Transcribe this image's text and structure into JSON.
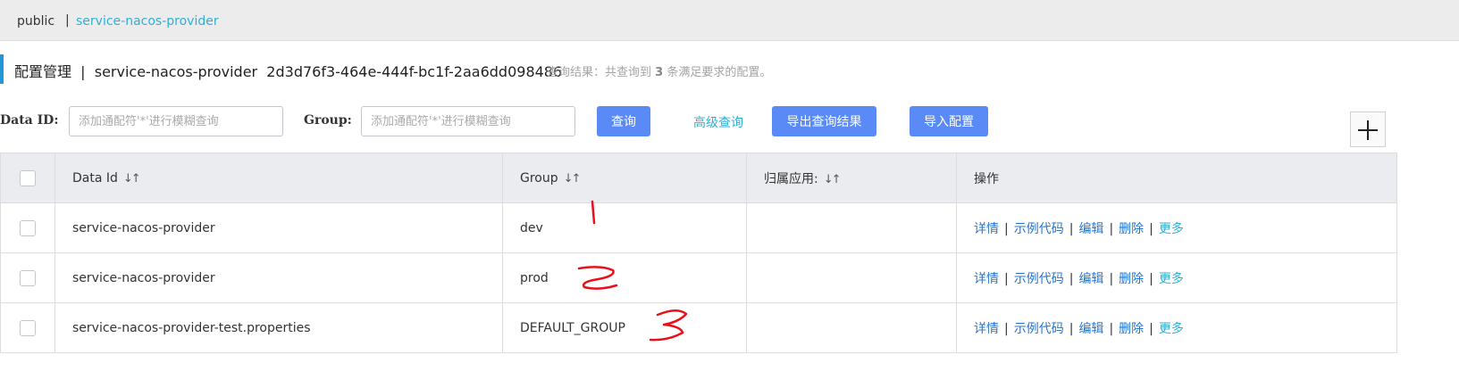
{
  "namespace_bar": {
    "public": "public",
    "separator": "|",
    "active": "service-nacos-provider"
  },
  "header": {
    "title": "配置管理  |  service-nacos-provider  2d3d76f3-464e-444f-bc1f-2aa6dd098486",
    "query_result_prefix": "查询结果：共查询到",
    "query_result_count": "3",
    "query_result_suffix": "条满足要求的配置。"
  },
  "filters": {
    "data_id_label": "Data ID:",
    "data_id_placeholder": "添加通配符'*'进行模糊查询",
    "group_label": "Group:",
    "group_placeholder": "添加通配符'*'进行模糊查询",
    "search_button": "查询",
    "advanced_link": "高级查询",
    "export_button": "导出查询结果",
    "import_button": "导入配置"
  },
  "table": {
    "columns": [
      "Data Id",
      "Group",
      "归属应用:",
      "操作"
    ],
    "rows": [
      {
        "data_id": "service-nacos-provider",
        "group": "dev",
        "app": ""
      },
      {
        "data_id": "service-nacos-provider",
        "group": "prod",
        "app": ""
      },
      {
        "data_id": "service-nacos-provider-test.properties",
        "group": "DEFAULT_GROUP",
        "app": ""
      }
    ],
    "actions": {
      "detail": "详情",
      "sample_code": "示例代码",
      "edit": "编辑",
      "delete": "删除",
      "more": "更多",
      "separator": "|"
    }
  },
  "annotations": {
    "color": "#e8101a",
    "marks": [
      "1",
      "2",
      "3"
    ]
  },
  "colors": {
    "accent_bar": "#2196d9",
    "primary_button": "#5a8af6",
    "link": "#2077d6",
    "link_light": "#2eb0d6",
    "header_bg": "#ebecf0"
  }
}
